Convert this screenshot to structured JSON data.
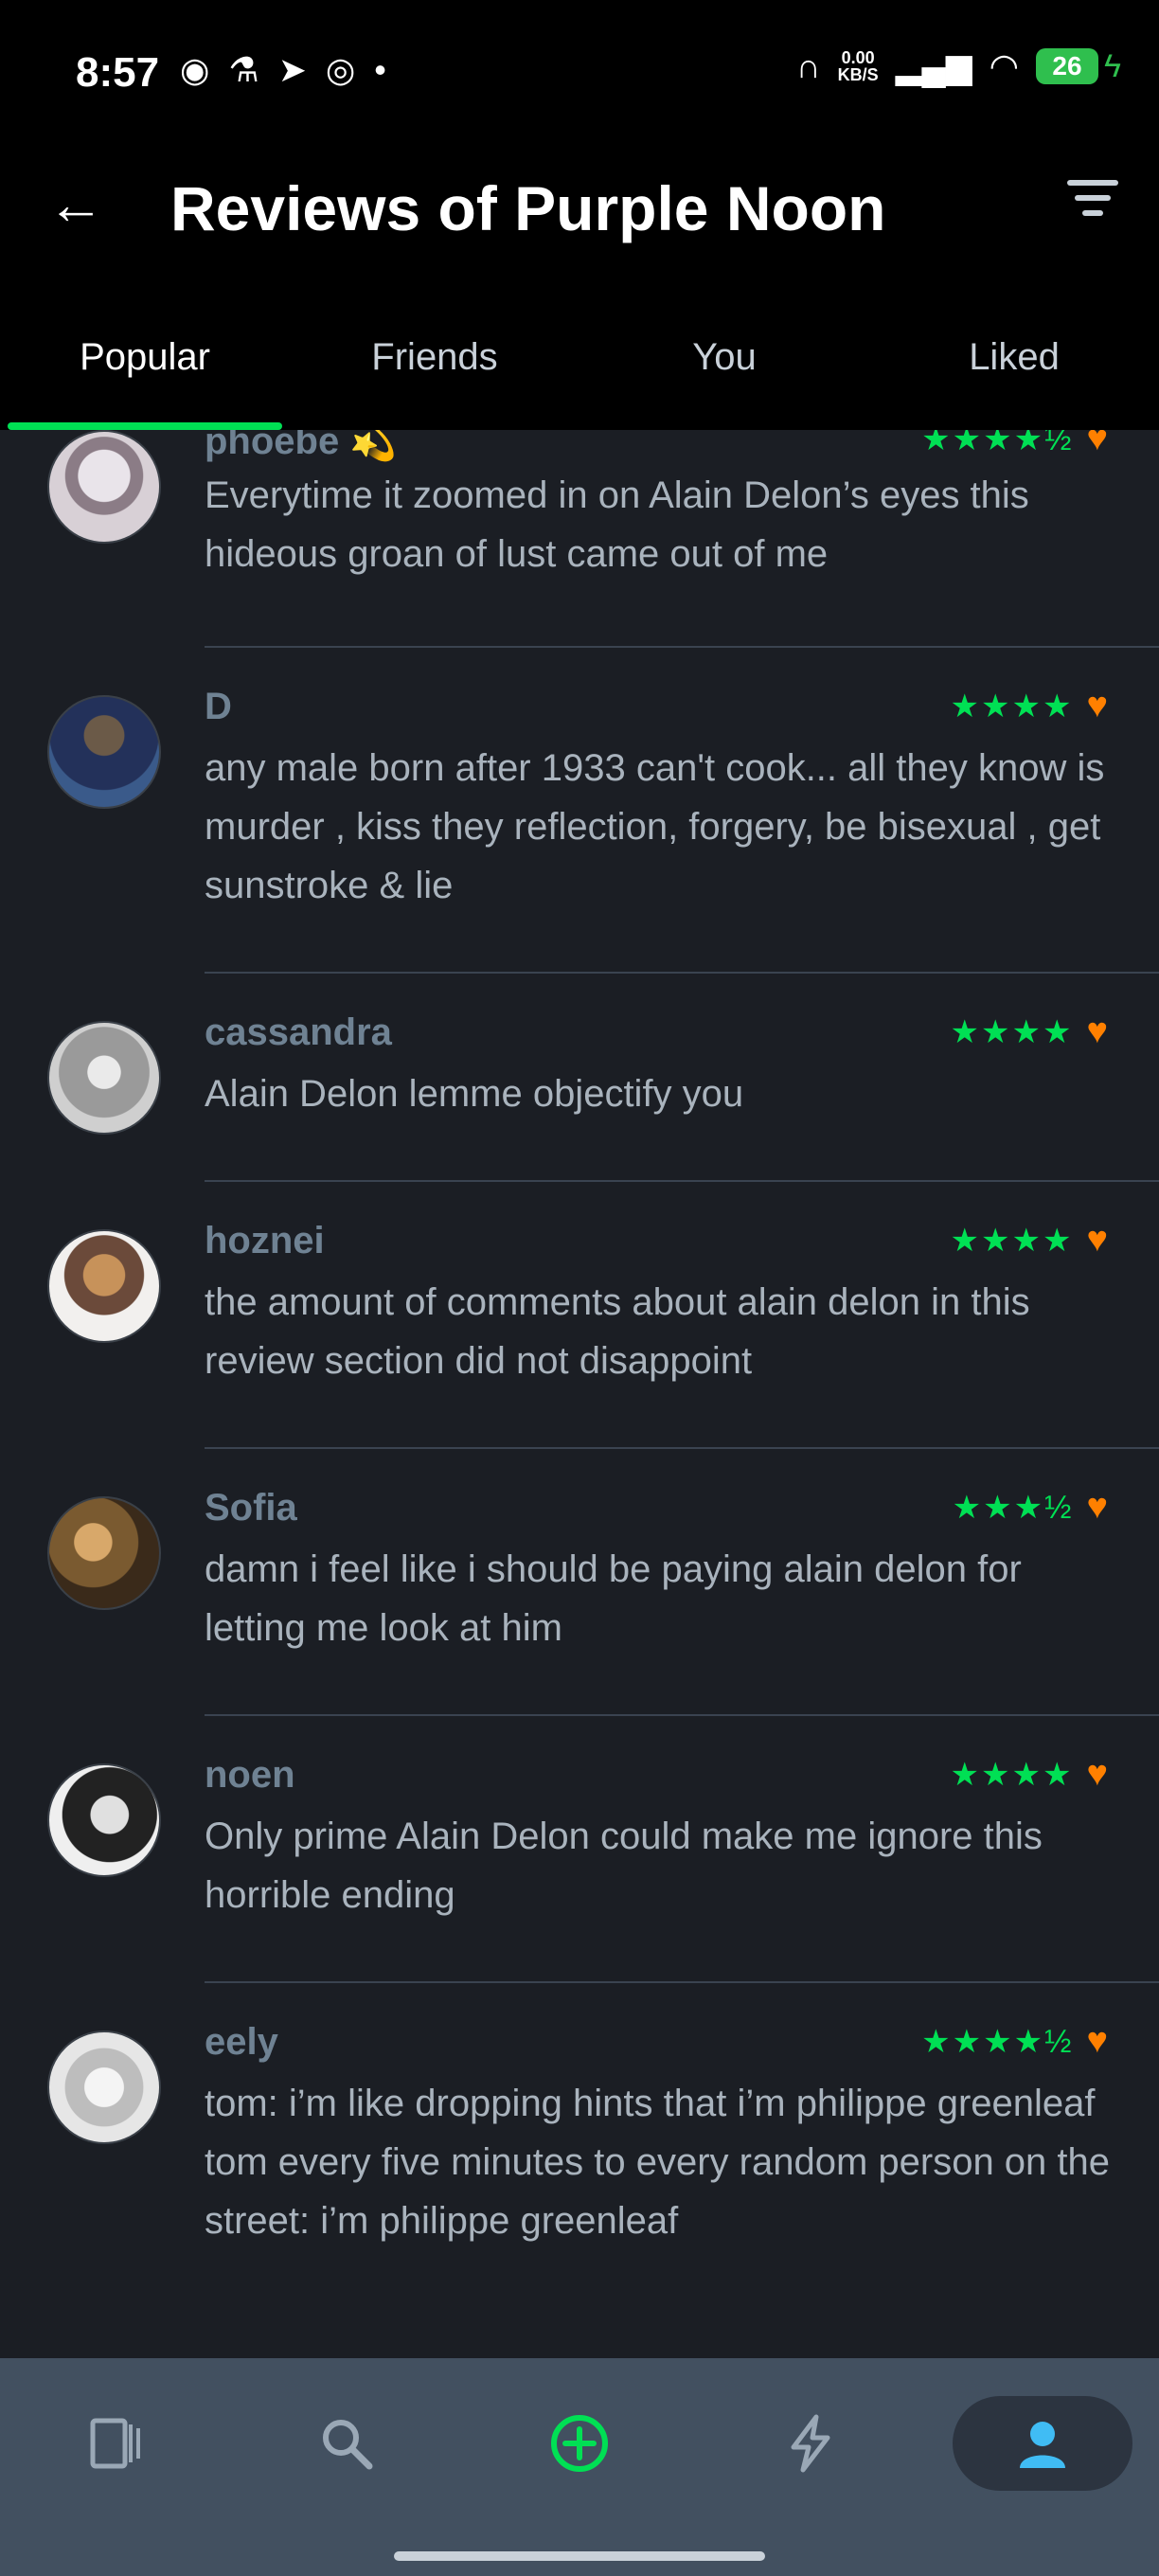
{
  "status_bar": {
    "time": "8:57",
    "net_speed_top": "0.00",
    "net_speed_bottom": "KB/S",
    "battery": "26"
  },
  "header": {
    "title": "Reviews of Purple Noon"
  },
  "tabs": [
    {
      "label": "Popular",
      "active": true
    },
    {
      "label": "Friends",
      "active": false
    },
    {
      "label": "You",
      "active": false
    },
    {
      "label": "Liked",
      "active": false
    }
  ],
  "reviews": [
    {
      "user": "phoebe 💫",
      "rating": "★★★★½",
      "liked": true,
      "text": "Everytime it zoomed in on Alain Delon’s eyes this hideous groan of lust came out of me"
    },
    {
      "user": "D",
      "rating": "★★★★",
      "liked": true,
      "text": "any male born after 1933 can't cook... all they know is murder , kiss they reflection, forgery, be bisexual , get sunstroke & lie"
    },
    {
      "user": "cassandra",
      "rating": "★★★★",
      "liked": true,
      "text": "Alain Delon lemme objectify you"
    },
    {
      "user": "hoznei",
      "rating": "★★★★",
      "liked": true,
      "text": "the amount of comments about alain delon in this review section did not disappoint"
    },
    {
      "user": "Sofia",
      "rating": "★★★½",
      "liked": true,
      "text": "damn i feel like i should be paying alain delon for letting me look at him"
    },
    {
      "user": "noen",
      "rating": "★★★★",
      "liked": true,
      "text": "Only prime Alain Delon could make me ignore this horrible ending"
    },
    {
      "user": "eely",
      "rating": "★★★★½",
      "liked": true,
      "text": "tom: i’m like dropping hints that i’m philippe greenleaf\ntom every five minutes to every random person on the street: i’m philippe greenleaf"
    }
  ],
  "bottom_nav": [
    {
      "icon": "films-icon",
      "glyph": "▯"
    },
    {
      "icon": "search-icon",
      "glyph": "⚲"
    },
    {
      "icon": "add-icon",
      "glyph": "⊕"
    },
    {
      "icon": "activity-icon",
      "glyph": "ϟ"
    },
    {
      "icon": "profile-icon",
      "glyph": "●"
    }
  ],
  "colors": {
    "accent_green": "#00e054",
    "heart_orange": "#ff8000",
    "background": "#1b1e24"
  }
}
